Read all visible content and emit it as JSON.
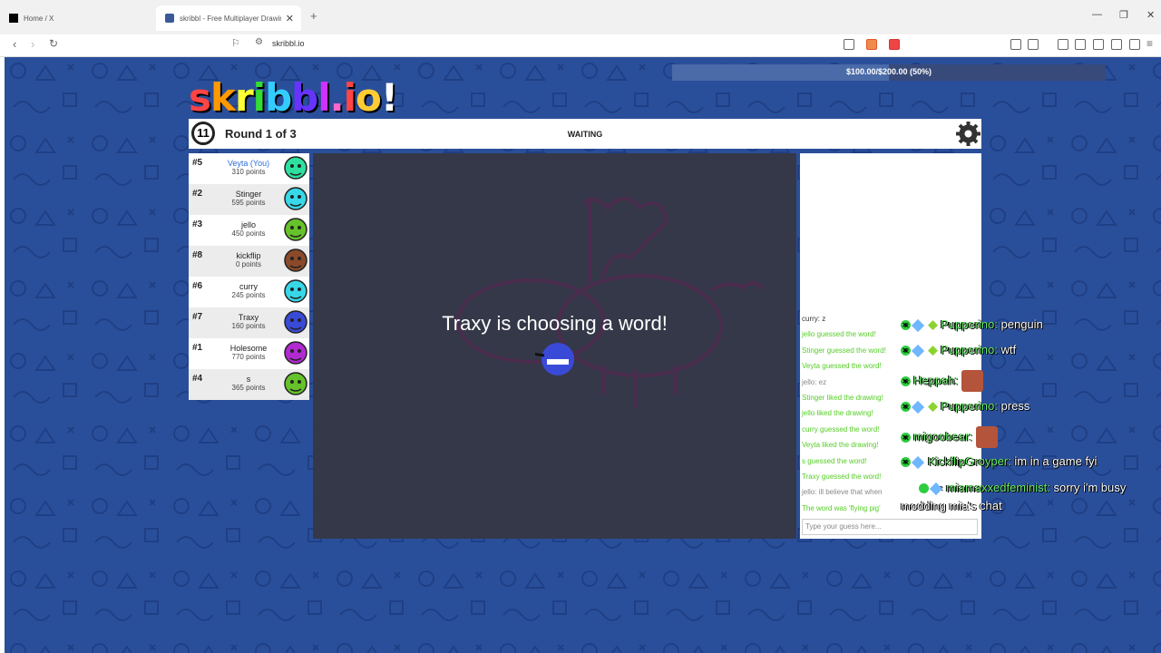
{
  "browser": {
    "tabs": [
      {
        "title": "Home / X"
      },
      {
        "title": "skribbl - Free Multiplayer Drawin"
      }
    ],
    "url": "skribbl.io"
  },
  "overlay": {
    "progress_text": "$100.00/$200.00 (50%)",
    "progress_fraction": 0.5
  },
  "game": {
    "logo": "skribbl.io",
    "timer": "11",
    "round": "Round 1 of 3",
    "status": "WAITING",
    "choosing": "Traxy is choosing a word!"
  },
  "players": [
    {
      "rank": "#5",
      "name": "Veyta (You)",
      "points": "310 points",
      "color": "#2ee0a0"
    },
    {
      "rank": "#2",
      "name": "Stinger",
      "points": "595 points",
      "color": "#38d8e8"
    },
    {
      "rank": "#3",
      "name": "jello",
      "points": "450 points",
      "color": "#66c22a"
    },
    {
      "rank": "#8",
      "name": "kickflip",
      "points": "0 points",
      "color": "#8a4a2a"
    },
    {
      "rank": "#6",
      "name": "curry",
      "points": "245 points",
      "color": "#38d8e8"
    },
    {
      "rank": "#7",
      "name": "Traxy",
      "points": "160 points",
      "color": "#3a4ad8"
    },
    {
      "rank": "#1",
      "name": "Holesome",
      "points": "770 points",
      "color": "#b02ad0"
    },
    {
      "rank": "#4",
      "name": "s",
      "points": "365 points",
      "color": "#66c22a"
    }
  ],
  "chat": {
    "messages": [
      {
        "text": "curry: z",
        "color": "#333333"
      },
      {
        "text": "jello guessed the word!",
        "color": "#56ce27"
      },
      {
        "text": "Stinger guessed the word!",
        "color": "#56ce27"
      },
      {
        "text": "Veyta guessed the word!",
        "color": "#56ce27"
      },
      {
        "text": "jello: ez",
        "color": "#888888"
      },
      {
        "text": "Stinger liked the drawing!",
        "color": "#56ce27"
      },
      {
        "text": "jello liked the drawing!",
        "color": "#56ce27"
      },
      {
        "text": "curry guessed the word!",
        "color": "#56ce27"
      },
      {
        "text": "Veyta liked the drawing!",
        "color": "#56ce27"
      },
      {
        "text": "s guessed the word!",
        "color": "#56ce27"
      },
      {
        "text": "Traxy guessed the word!",
        "color": "#56ce27"
      },
      {
        "text": "jello: ill believe that when",
        "color": "#888888"
      },
      {
        "text": "The word was 'flying pig'",
        "color": "#56ce27"
      }
    ],
    "input_placeholder": "Type your guess here..."
  },
  "stream_chat": [
    {
      "user": "Pupperino:",
      "message": "penguin"
    },
    {
      "user": "Pupperino:",
      "message": "wtf"
    },
    {
      "user": "Heppah:",
      "message": ""
    },
    {
      "user": "Pupperino:",
      "message": "press"
    },
    {
      "user": "migoobear:",
      "message": ""
    },
    {
      "user": "KickflipGroyper:",
      "message": "im in a game fyi"
    },
    {
      "user": "miamaxxedfeminist:",
      "message": "sorry i'm busy modding mia's chat"
    }
  ]
}
